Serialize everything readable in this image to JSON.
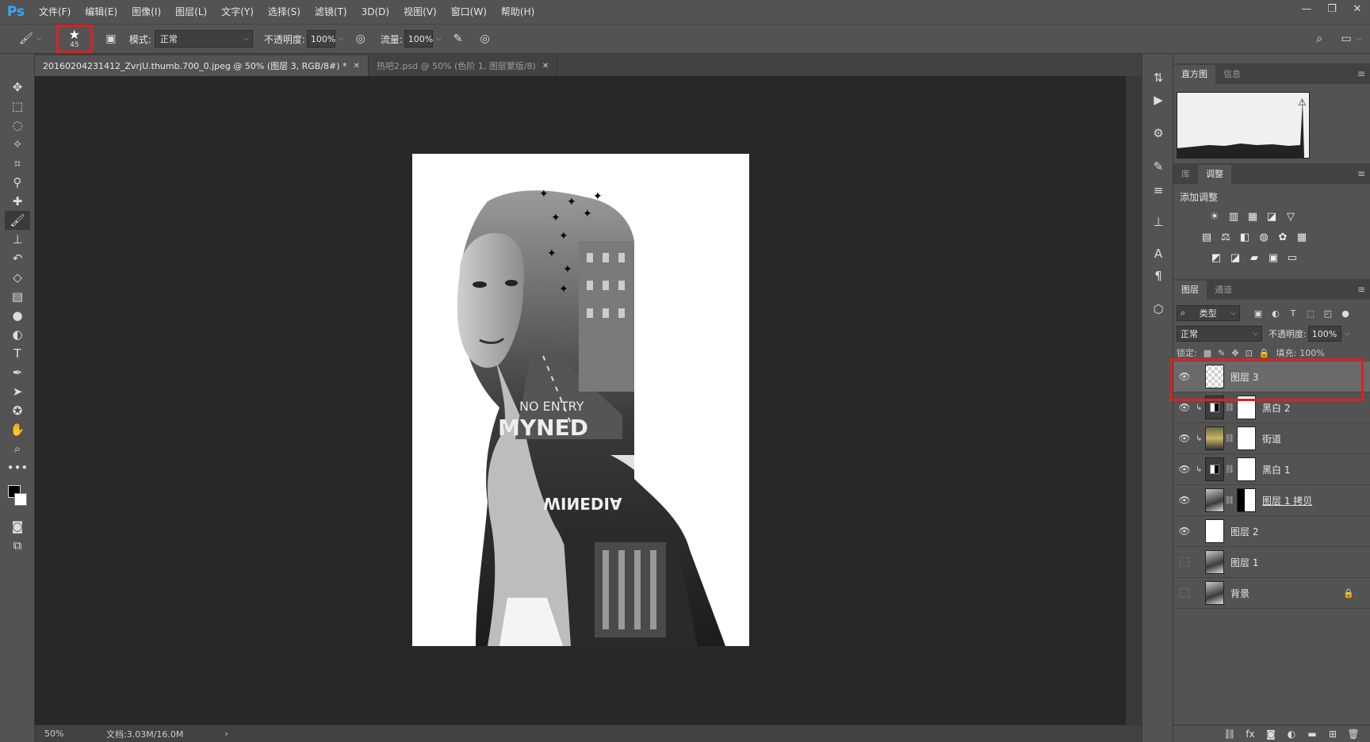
{
  "app": {
    "logo": "Ps"
  },
  "menu": [
    "文件(F)",
    "编辑(E)",
    "图像(I)",
    "图层(L)",
    "文字(Y)",
    "选择(S)",
    "滤镜(T)",
    "3D(D)",
    "视图(V)",
    "窗口(W)",
    "帮助(H)"
  ],
  "window_controls": {
    "minimize": "—",
    "restore": "❐",
    "close": "✕"
  },
  "options": {
    "brush_size": "45",
    "mode_label": "模式:",
    "mode_value": "正常",
    "opacity_label": "不透明度:",
    "opacity_value": "100%",
    "flow_label": "流量:",
    "flow_value": "100%"
  },
  "tabs": [
    {
      "label": "20160204231412_ZvrjU.thumb.700_0.jpeg @ 50% (图层 3, RGB/8#) *",
      "close": "✕"
    },
    {
      "label": "热吧2.psd @ 50% (色阶 1, 图层蒙版/8)",
      "close": "✕"
    }
  ],
  "status": {
    "zoom": "50%",
    "doc_info": "文档:3.03M/16.0M",
    "arrow": "›"
  },
  "canvas_art": {
    "road_text_1": "NO ENTRY",
    "road_text_2": "MYNED",
    "road_text_3": "WINEDIA"
  },
  "panels": {
    "histogram_tabs": [
      "直方图",
      "信息"
    ],
    "adjust_tabs": [
      "库",
      "调整"
    ],
    "adjust_title": "添加调整",
    "layers_tabs": [
      "图层",
      "通道"
    ],
    "filter_kind": "类型",
    "blend_mode": "正常",
    "opacity_label": "不透明度:",
    "opacity_value": "100%",
    "lock_label": "锁定:",
    "fill_label": "填充:",
    "fill_value": "100%"
  },
  "layers": [
    {
      "name": "图层 3",
      "visible": true,
      "thumb": "checker",
      "selected": true
    },
    {
      "name": "黑白 2",
      "visible": true,
      "thumb": "adj",
      "mask": true,
      "clip": true
    },
    {
      "name": "街道",
      "visible": true,
      "thumb": "street",
      "mask": true,
      "clip": true
    },
    {
      "name": "黑白 1",
      "visible": true,
      "thumb": "adj",
      "mask": true,
      "clip": true
    },
    {
      "name": "图层 1 拷贝",
      "visible": true,
      "thumb": "photo",
      "mask": true,
      "underline": true
    },
    {
      "name": "图层 2",
      "visible": true,
      "thumb": "white"
    },
    {
      "name": "图层 1",
      "visible": false,
      "thumb": "photo"
    },
    {
      "name": "背景",
      "visible": false,
      "thumb": "photo",
      "locked": true
    }
  ],
  "colors": {
    "highlight": "#e02020",
    "ps_blue": "#31a8ff"
  }
}
